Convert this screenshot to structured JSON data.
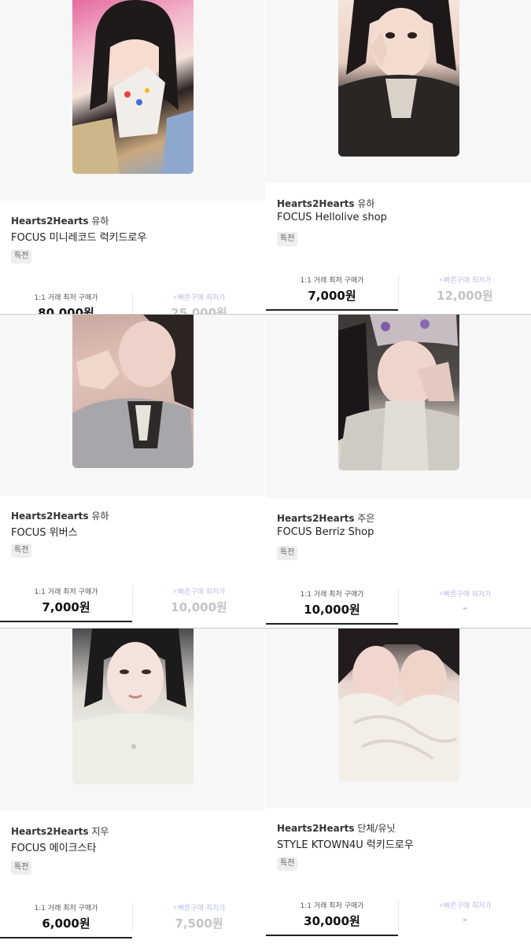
{
  "cards": [
    {
      "group": "Hearts2Hearts",
      "member": "유하",
      "title": "FOCUS 미니레코드 럭키드로우",
      "badge": "특전",
      "price_label": "1:1 거래 최저 구매가",
      "price": "80,000원",
      "fast_label": "빠른구매 최저가",
      "fast_price": "25,000원"
    },
    {
      "group": "Hearts2Hearts",
      "member": "유하",
      "title": "FOCUS Hellolive shop",
      "badge": "특전",
      "price_label": "1:1 거래 최저 구매가",
      "price": "7,000원",
      "fast_label": "빠른구매 최저가",
      "fast_price": "12,000원"
    },
    {
      "group": "Hearts2Hearts",
      "member": "유하",
      "title": "FOCUS 위버스",
      "badge": "특전",
      "price_label": "1:1 거래 최저 구매가",
      "price": "7,000원",
      "fast_label": "빠른구매 최저가",
      "fast_price": "10,000원"
    },
    {
      "group": "Hearts2Hearts",
      "member": "주은",
      "title": "FOCUS Berriz Shop",
      "badge": "특전",
      "price_label": "1:1 거래 최저 구매가",
      "price": "10,000원",
      "fast_label": "빠른구매 최저가",
      "fast_price": "-"
    },
    {
      "group": "Hearts2Hearts",
      "member": "지우",
      "title": "FOCUS 메이크스타",
      "badge": "특전",
      "price_label": "1:1 거래 최저 구매가",
      "price": "6,000원",
      "fast_label": "빠른구매 최저가",
      "fast_price": "7,500원"
    },
    {
      "group": "Hearts2Hearts",
      "member": "단체/유닛",
      "title": "STYLE KTOWN4U 럭키드로우",
      "badge": "특전",
      "price_label": "1:1 거래 최저 구매가",
      "price": "30,000원",
      "fast_label": "빠른구매 최저가",
      "fast_price": "-"
    }
  ],
  "icons": {
    "fast_purchase": "lightning-icon"
  },
  "colors": {
    "fast_label": "#b9bde8",
    "muted_price": "#c4c4c4",
    "underline": "#222222"
  }
}
